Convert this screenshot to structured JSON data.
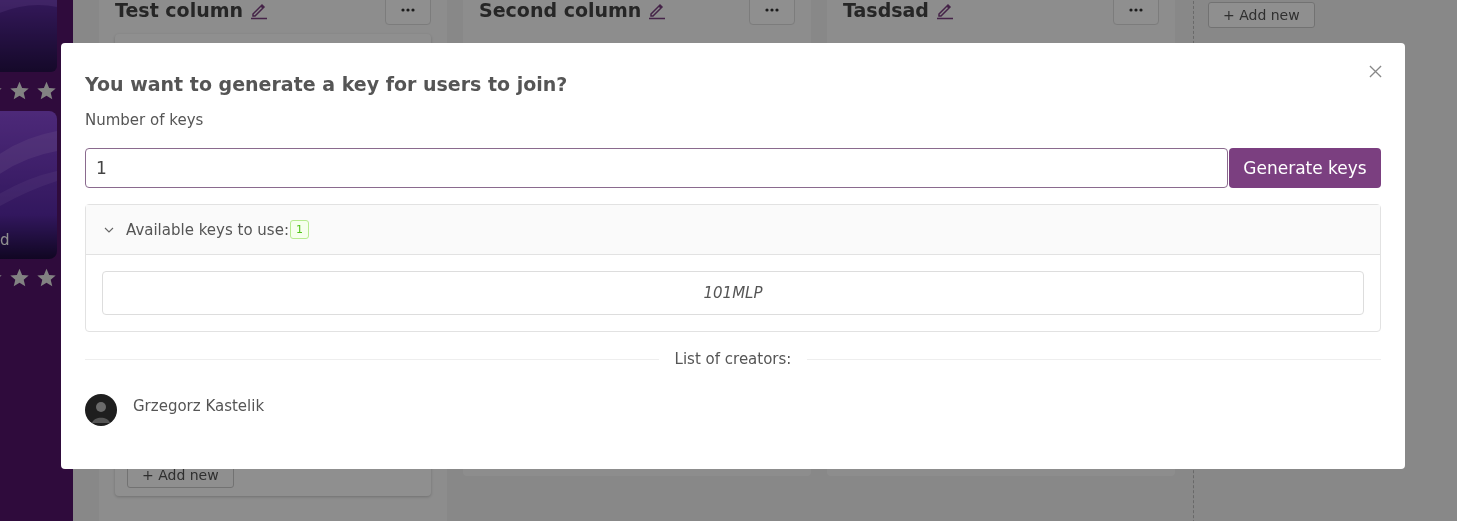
{
  "sidebar": {
    "card_label": "d"
  },
  "board": {
    "columns": [
      {
        "title": "Test column",
        "add_button": "+ Add new"
      },
      {
        "title": "Second column"
      },
      {
        "title": "Tasdsad"
      }
    ],
    "new_column_button": "+ Add new"
  },
  "modal": {
    "title": "You want to generate a key for users to join?",
    "field_label": "Number of keys",
    "field_value": "1",
    "generate_button": "Generate keys",
    "keys_panel": {
      "title": "Available keys to use:",
      "count": "1",
      "expanded": true,
      "keys": [
        "101MLP"
      ]
    },
    "creators_heading": "List of creators:",
    "creators": [
      {
        "name": "Grzegorz Kastelik"
      }
    ]
  }
}
